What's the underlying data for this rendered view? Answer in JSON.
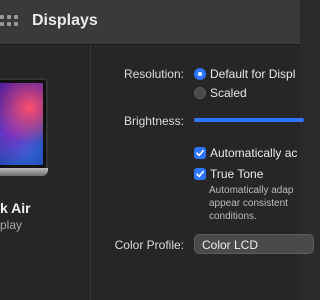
{
  "window": {
    "title": "Displays"
  },
  "device": {
    "name": "k Air",
    "subtitle": "play"
  },
  "settings": {
    "resolution": {
      "label": "Resolution:",
      "options": [
        "Default for Displ",
        "Scaled"
      ],
      "selected": "Default for Displ"
    },
    "brightness": {
      "label": "Brightness:",
      "level_fraction": 1.0
    },
    "auto_adjust": {
      "label": "Automatically ac",
      "checked": true
    },
    "true_tone": {
      "label": "True Tone",
      "checked": true,
      "description_lines": [
        "Automatically adap",
        "appear consistent",
        "conditions."
      ]
    },
    "color_profile": {
      "label": "Color Profile:",
      "value": "Color LCD"
    }
  },
  "colors": {
    "accent": "#2f74ff",
    "background": "#262628",
    "toolbar": "#3a3a3c"
  },
  "icons": {
    "grid": "grid-icon",
    "checkmark": "checkmark-icon",
    "laptop": "laptop-image"
  }
}
